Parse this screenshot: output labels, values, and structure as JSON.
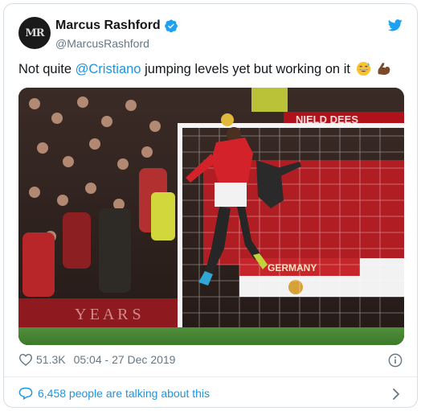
{
  "tweet": {
    "author": {
      "display_name": "Marcus Rashford",
      "handle": "@MarcusRashford",
      "avatar_monogram": "MR",
      "verified": true
    },
    "text": {
      "before_mention": "Not quite ",
      "mention": "@Cristiano",
      "after_mention": " jumping levels yet but working on it",
      "emojis": [
        "sweat-smile-emoji",
        "flexed-biceps-emoji"
      ]
    },
    "photo": {
      "banner_text": "GERMANY",
      "sign_text": "NIELD DEES"
    },
    "likes": "51.3K",
    "timestamp": "05:04 - 27 Dec 2019",
    "talking_link": "6,458 people are talking about this"
  },
  "colors": {
    "link": "#1b95e0",
    "muted": "#657786",
    "text": "#14171a",
    "border": "#d6dee3"
  },
  "icons": [
    "verified-badge-icon",
    "twitter-bird-icon",
    "heart-icon",
    "info-icon",
    "speech-bubble-icon",
    "chevron-right-icon"
  ]
}
